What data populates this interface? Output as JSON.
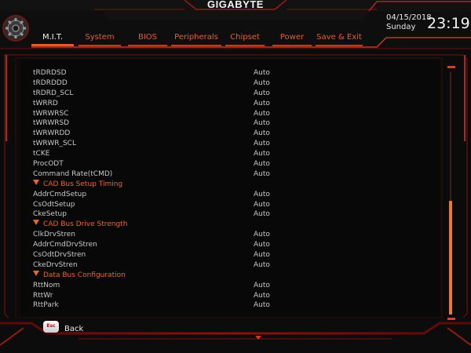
{
  "header": {
    "brand": "GIGABYTE",
    "date": "04/15/2018",
    "day": "Sunday",
    "time": "23:19"
  },
  "tabs": [
    {
      "label": "M.I.T.",
      "active": true
    },
    {
      "label": "System"
    },
    {
      "label": "BIOS"
    },
    {
      "label": "Peripherals"
    },
    {
      "label": "Chipset"
    },
    {
      "label": "Power"
    },
    {
      "label": "Save & Exit"
    }
  ],
  "settings": [
    {
      "label": "tRDRDSD",
      "value": "Auto"
    },
    {
      "label": "tRDRDDD",
      "value": "Auto"
    },
    {
      "label": "tRDRD_SCL",
      "value": "Auto"
    },
    {
      "label": "tWRRD",
      "value": "Auto"
    },
    {
      "label": "tWRWRSC",
      "value": "Auto"
    },
    {
      "label": "tWRWRSD",
      "value": "Auto"
    },
    {
      "label": "tWRWRDD",
      "value": "Auto"
    },
    {
      "label": "tWRWR_SCL",
      "value": "Auto"
    },
    {
      "label": "tCKE",
      "value": "Auto"
    },
    {
      "label": "ProcODT",
      "value": "Auto"
    },
    {
      "label": "Command Rate(tCMD)",
      "value": "Auto"
    },
    {
      "label": "CAD Bus Setup Timing",
      "section": true
    },
    {
      "label": "AddrCmdSetup",
      "value": "Auto"
    },
    {
      "label": "CsOdtSetup",
      "value": "Auto"
    },
    {
      "label": "CkeSetup",
      "value": "Auto"
    },
    {
      "label": "CAD Bus Drive Strength",
      "section": true
    },
    {
      "label": "ClkDrvStren",
      "value": "Auto"
    },
    {
      "label": "AddrCmdDrvStren",
      "value": "Auto"
    },
    {
      "label": "CsOdtDrvStren",
      "value": "Auto"
    },
    {
      "label": "CkeDrvStren",
      "value": "Auto"
    },
    {
      "label": "Data Bus Configuration",
      "section": true
    },
    {
      "label": "RttNom",
      "value": "Auto"
    },
    {
      "label": "RttWr",
      "value": "Auto"
    },
    {
      "label": "RttPark",
      "value": "Auto"
    }
  ],
  "footer": {
    "esc_key": "Esc",
    "back_label": "Back"
  },
  "scroll": {
    "thumb_start_fraction": 0.53,
    "thumb_size_fraction": 0.44
  },
  "colors": {
    "accent": "#e55a2a",
    "frame_red": "#c5361c",
    "section_text": "#e4682c",
    "background": "#0b0b0b"
  }
}
